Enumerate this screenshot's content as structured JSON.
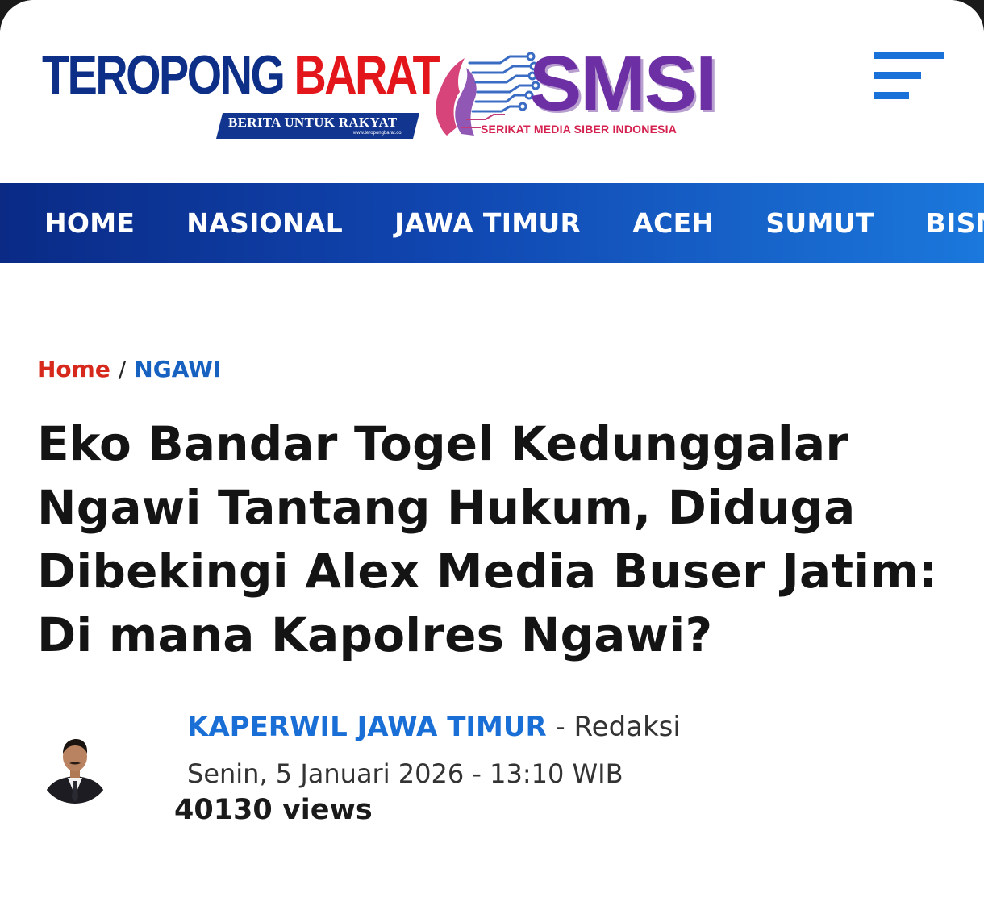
{
  "header": {
    "logo_word_1": "TEROPONG",
    "logo_word_2": "BARAT",
    "logo_tagline": "BERITA UNTUK RAKYAT",
    "logo_url": "www.teropongbarat.co",
    "partner_logo_word": "SMSI",
    "partner_logo_sub": "SERIKAT MEDIA SIBER INDONESIA",
    "menu_icon": "hamburger-menu-icon"
  },
  "nav": {
    "items": [
      {
        "label": "HOME"
      },
      {
        "label": "NASIONAL"
      },
      {
        "label": "JAWA TIMUR"
      },
      {
        "label": "ACEH"
      },
      {
        "label": "SUMUT"
      },
      {
        "label": "BISNIS"
      }
    ]
  },
  "breadcrumb": {
    "home": "Home",
    "separator": "/",
    "category": "NGAWI"
  },
  "article": {
    "title": "Eko Bandar Togel Kedunggalar Ngawi Tantang Hukum, Diduga Dibekingi Alex Media Buser Jatim: Di mana Kapolres Ngawi?",
    "author_name": "KAPERWIL JAWA TIMUR",
    "author_role": " - Redaksi",
    "date": "Senin, 5 Januari 2026 - 13:10 WIB",
    "views": "40130 views"
  },
  "colors": {
    "brand_blue": "#0d2f87",
    "brand_red": "#e3171b",
    "nav_gradient_start": "#0a2a86",
    "nav_gradient_end": "#1b78dc",
    "link_blue": "#1a6fd6",
    "breadcrumb_red": "#d6291c",
    "smsi_purple": "#6c2fa4"
  }
}
